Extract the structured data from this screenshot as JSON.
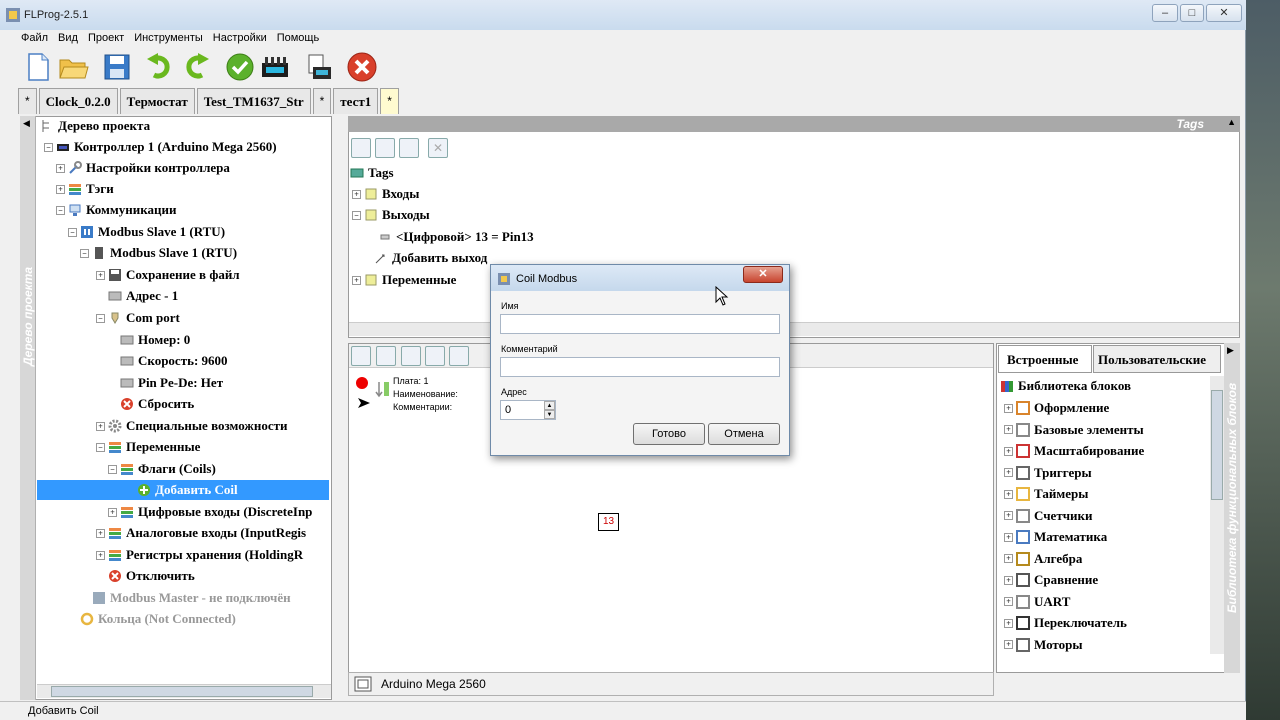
{
  "window": {
    "title": "FLProg-2.5.1"
  },
  "menu": [
    "Файл",
    "Вид",
    "Проект",
    "Инструменты",
    "Настройки",
    "Помощь"
  ],
  "tabs": [
    {
      "label": "*",
      "active": false
    },
    {
      "label": "Clock_0.2.0",
      "active": false
    },
    {
      "label": "Термостат",
      "active": false
    },
    {
      "label": "Test_TM1637_Str",
      "active": false
    },
    {
      "label": "*",
      "active": false
    },
    {
      "label": "тест1",
      "active": false
    },
    {
      "label": "*",
      "active": true
    }
  ],
  "left_panel": {
    "vertical_label": "Дерево проекта",
    "tree": [
      {
        "label": "Дерево проекта"
      },
      {
        "label": "Контроллер 1 (Arduino Mega 2560)"
      },
      {
        "label": "Настройки контроллера"
      },
      {
        "label": "Тэги"
      },
      {
        "label": "Коммуникации"
      },
      {
        "label": "Modbus Slave 1 (RTU)"
      },
      {
        "label": "Modbus Slave 1 (RTU)"
      },
      {
        "label": "Сохранение в файл"
      },
      {
        "label": "Адрес - 1"
      },
      {
        "label": "Com port"
      },
      {
        "label": "Номер: 0"
      },
      {
        "label": "Скорость: 9600"
      },
      {
        "label": "Pin Pe-De: Нет"
      },
      {
        "label": "Сбросить"
      },
      {
        "label": "Специальные возможности"
      },
      {
        "label": "Переменные"
      },
      {
        "label": "Флаги (Coils)"
      },
      {
        "label": "Добавить Coil"
      },
      {
        "label": "Цифровые входы (DiscreteInp"
      },
      {
        "label": "Аналоговые входы (InputRegis"
      },
      {
        "label": "Регистры хранения (HoldingR"
      },
      {
        "label": "Отключить"
      },
      {
        "label": "Modbus Master  - не подключён"
      },
      {
        "label": "Кольца (Not Connected)"
      }
    ]
  },
  "tags_panel": {
    "header": "Tags",
    "tree": [
      {
        "label": "Tags"
      },
      {
        "label": "Входы"
      },
      {
        "label": "Выходы"
      },
      {
        "label": "<Цифровой> 13 = Pin13"
      },
      {
        "label": "Добавить выход"
      },
      {
        "label": "Переменные"
      }
    ]
  },
  "canvas": {
    "block_info": {
      "plate": "Плата: 1",
      "name": "Наименование:",
      "comment": "Комментарии:"
    },
    "pin_label": "13",
    "board": "Arduino Mega 2560"
  },
  "library": {
    "tabs": [
      "Встроенные",
      "Пользовательские"
    ],
    "vertical_label": "Библиотека функциональных блоков",
    "root": "Библиотека блоков",
    "items": [
      "Оформление",
      "Базовые элементы",
      "Масштабирование",
      "Триггеры",
      "Таймеры",
      "Счетчики",
      "Математика",
      "Алгебра",
      "Сравнение",
      "UART",
      "Переключатель",
      "Моторы"
    ]
  },
  "dialog": {
    "title": "Coil Modbus",
    "name_label": "Имя",
    "name_value": "",
    "comment_label": "Комментарий",
    "comment_value": "",
    "address_label": "Адрес",
    "address_value": "0",
    "ok": "Готово",
    "cancel": "Отмена"
  },
  "statusbar": {
    "text": "Добавить Coil"
  },
  "colors": {
    "selection": "#3399ff",
    "close_red": "#d9402b",
    "tab_active": "#fffbd0"
  }
}
